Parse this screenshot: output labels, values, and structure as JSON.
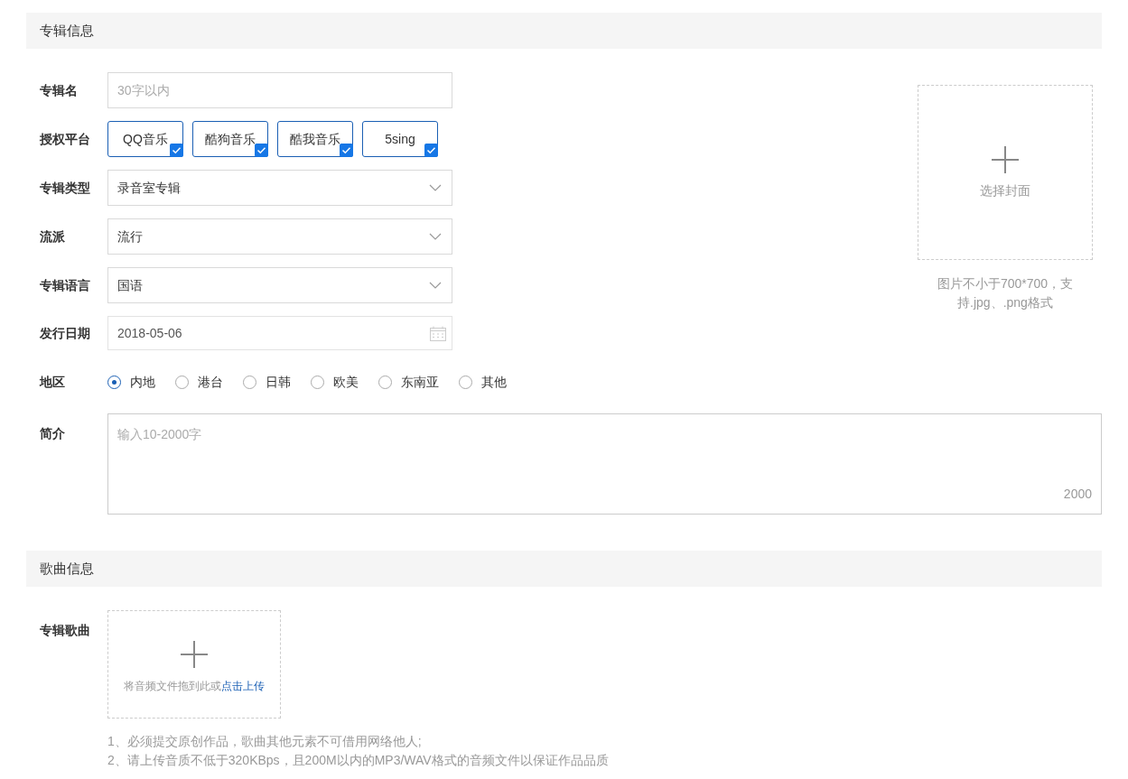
{
  "album_section": {
    "title": "专辑信息",
    "name_field": {
      "label": "专辑名",
      "placeholder": "30字以内"
    },
    "platforms": {
      "label": "授权平台",
      "items": [
        {
          "label": "QQ音乐",
          "checked": true
        },
        {
          "label": "酷狗音乐",
          "checked": true
        },
        {
          "label": "酷我音乐",
          "checked": true
        },
        {
          "label": "5sing",
          "checked": true
        }
      ]
    },
    "selects": [
      {
        "label": "专辑类型",
        "value": "录音室专辑"
      },
      {
        "label": "流派",
        "value": "流行"
      },
      {
        "label": "专辑语言",
        "value": "国语"
      }
    ],
    "release_date": {
      "label": "发行日期",
      "value": "2018-05-06"
    },
    "region": {
      "label": "地区",
      "options": [
        {
          "label": "内地",
          "selected": true
        },
        {
          "label": "港台",
          "selected": false
        },
        {
          "label": "日韩",
          "selected": false
        },
        {
          "label": "欧美",
          "selected": false
        },
        {
          "label": "东南亚",
          "selected": false
        },
        {
          "label": "其他",
          "selected": false
        }
      ]
    },
    "intro": {
      "label": "简介",
      "placeholder": "输入10-2000字",
      "counter": "2000"
    },
    "cover": {
      "button": "选择封面",
      "hint": "图片不小于700*700，支持.jpg、.png格式"
    }
  },
  "song_section": {
    "title": "歌曲信息",
    "songs": {
      "label": "专辑歌曲",
      "drop_text": "将音频文件拖到此或",
      "drop_link": "点击上传"
    },
    "notes": [
      "1、必须提交原创作品，歌曲其他元素不可借用网络他人;",
      "2、请上传音质不低于320KBps，且200M以内的MP3/WAV格式的音频文件以保证作品品质"
    ]
  }
}
